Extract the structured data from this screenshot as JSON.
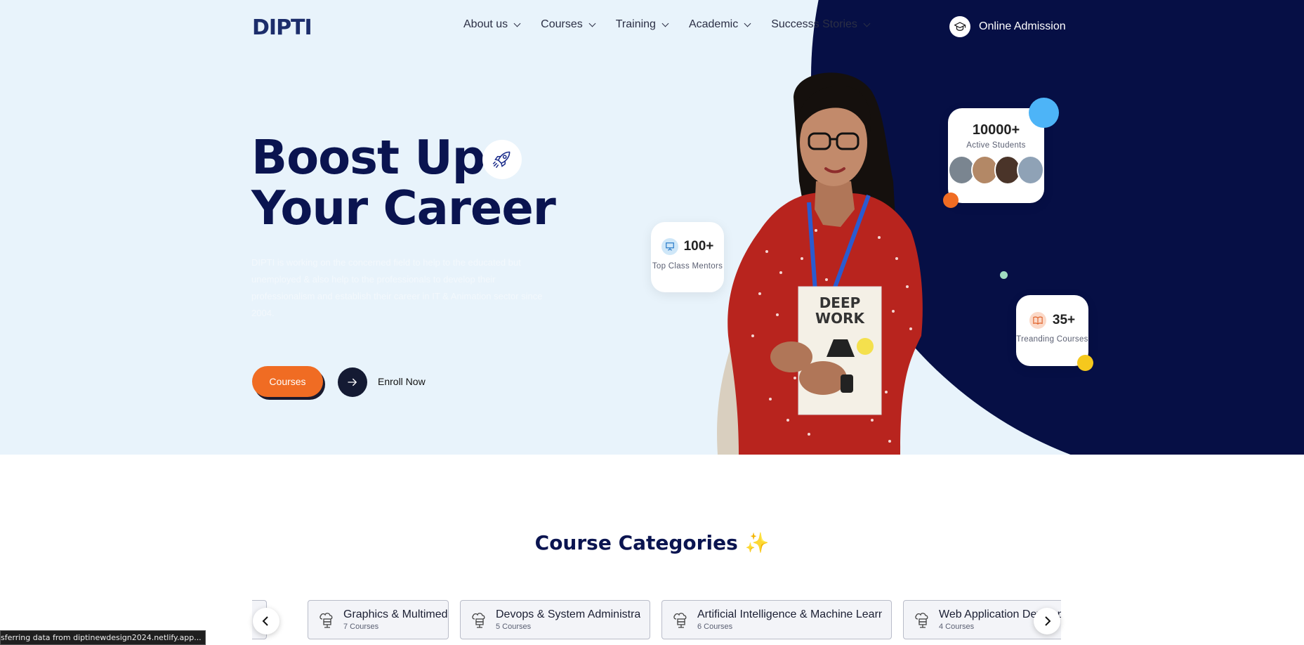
{
  "header": {
    "logo_text": "DIPTI",
    "nav": [
      {
        "label": "About us"
      },
      {
        "label": "Courses"
      },
      {
        "label": "Training"
      },
      {
        "label": "Academic"
      },
      {
        "label": "Successs Stories"
      }
    ],
    "admission_label": "Online Admission"
  },
  "hero": {
    "title_line1": "Boost Up",
    "title_line2": "Your Career",
    "description": "DIPTI is working on the concerned field to help to the educated but unemployed & also help to the professionals to develop their professionalism and establish their career in IT & Animation sector since 2004.",
    "courses_button": "Courses",
    "enroll_label": "Enroll Now"
  },
  "stats": {
    "students": {
      "value": "10000+",
      "label": "Active Students"
    },
    "mentors": {
      "value": "100+",
      "label": "Top Class Mentors"
    },
    "courses": {
      "value": "35+",
      "label": "Treanding Courses"
    }
  },
  "categories": {
    "title": "Course Categories",
    "title_emoji": "✨",
    "items": [
      {
        "name": "Graphics & Multimedia",
        "count": "7 Courses"
      },
      {
        "name": "Devops & System Administration",
        "count": "5 Courses"
      },
      {
        "name": "Artificial Intelligence & Machine Learning",
        "count": "6 Courses"
      },
      {
        "name": "Web Application Development",
        "count": "4 Courses"
      }
    ]
  },
  "status_bar": {
    "text": "sferring data from diptinewdesign2024.netlify.app..."
  },
  "colors": {
    "navy": "#060f45",
    "accent_orange": "#f06c23",
    "hero_bg": "#e8f3fb"
  },
  "icons": [
    "chevron-down-icon",
    "graduation-cap-icon",
    "rocket-icon",
    "arrow-right-icon",
    "presentation-icon",
    "book-icon",
    "server-cloud-icon",
    "chevron-left-icon",
    "chevron-right-icon"
  ]
}
